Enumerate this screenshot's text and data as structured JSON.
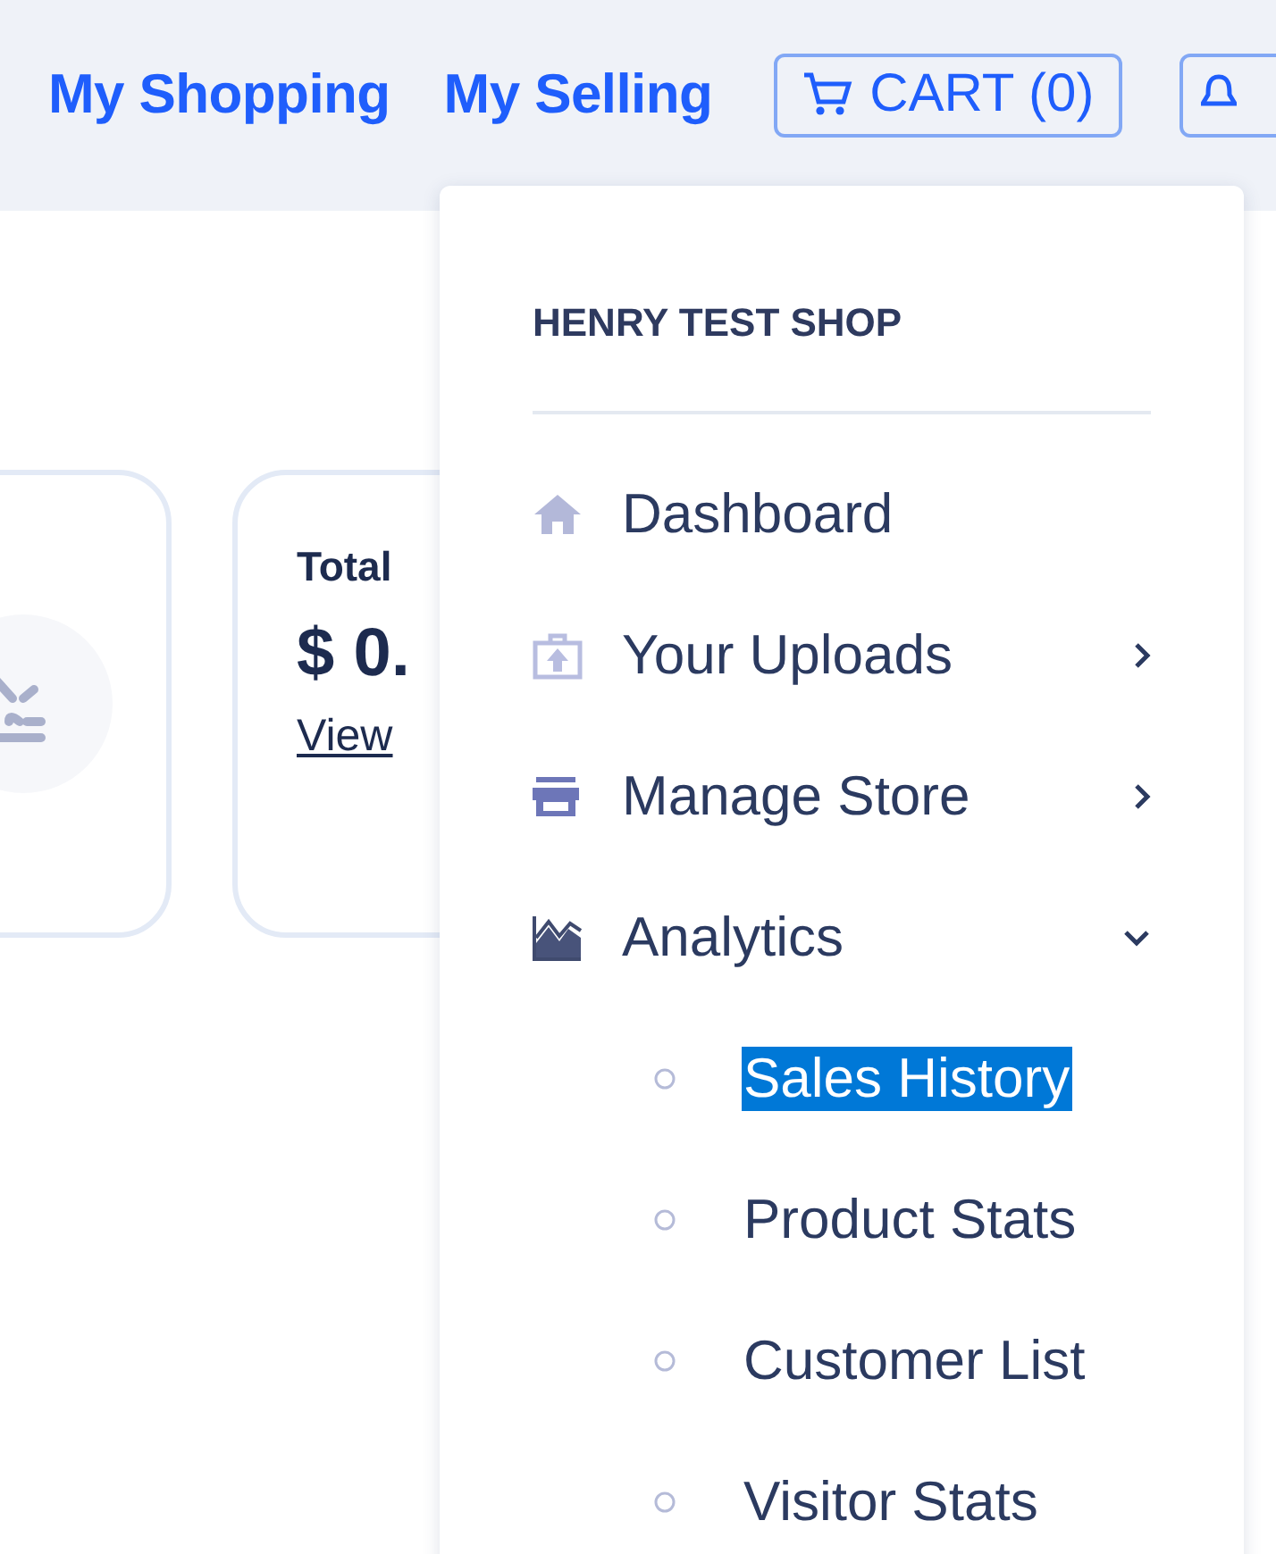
{
  "nav": {
    "links": [
      {
        "label": "My Shopping"
      },
      {
        "label": "My Selling"
      }
    ],
    "cart": {
      "label": "CART (0)"
    }
  },
  "cards": [
    {
      "kind": "icon"
    },
    {
      "kind": "stat",
      "title": "Total",
      "amount": "$ 0.",
      "link": "View"
    }
  ],
  "menu": {
    "title": "HENRY TEST SHOP",
    "items": [
      {
        "label": "Dashboard",
        "kind": "link"
      },
      {
        "label": "Your Uploads",
        "kind": "group",
        "expanded": false
      },
      {
        "label": "Manage Store",
        "kind": "group",
        "expanded": false
      },
      {
        "label": "Analytics",
        "kind": "group",
        "expanded": true,
        "children": [
          {
            "label": "Sales History",
            "selected": true
          },
          {
            "label": "Product Stats",
            "selected": false
          },
          {
            "label": "Customer List",
            "selected": false
          },
          {
            "label": "Visitor Stats",
            "selected": false
          }
        ]
      }
    ]
  }
}
